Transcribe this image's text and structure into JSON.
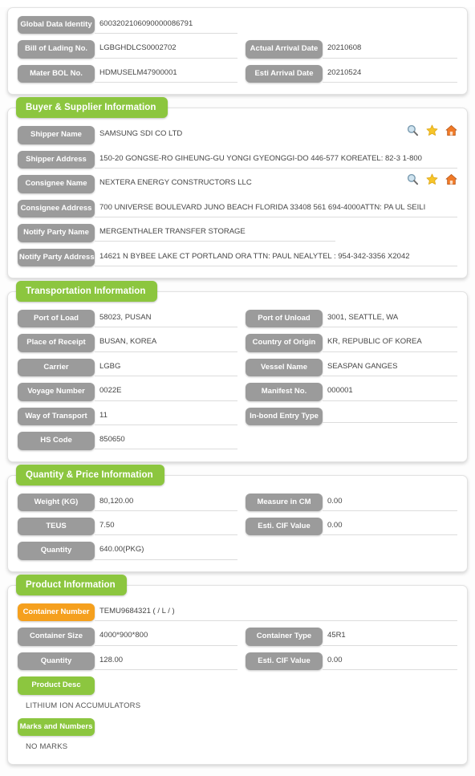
{
  "theme": {
    "accent_green": "#8cc63f",
    "pill_gray": "#9b9b9b",
    "pill_orange": "#f5a01e",
    "text": "#454545"
  },
  "header_card": {
    "fields": [
      {
        "label": "Global Data Identity",
        "value": "6003202106090000086791"
      },
      {
        "label": "Bill of Lading No.",
        "value": "LGBGHDLCS0002702"
      },
      {
        "label": "Actual Arrival Date",
        "value": "20210608"
      },
      {
        "label": "Mater BOL No.",
        "value": "HDMUSELM47900001"
      },
      {
        "label": "Esti Arrival Date",
        "value": "20210524"
      }
    ]
  },
  "buyer_supplier": {
    "title": "Buyer & Supplier Information",
    "fields": [
      {
        "label": "Shipper Name",
        "value": "SAMSUNG SDI CO LTD"
      },
      {
        "label": "Shipper Address",
        "value": "150-20 GONGSE-RO GIHEUNG-GU YONGI GYEONGGI-DO 446-577 KOREATEL: 82-3 1-800"
      },
      {
        "label": "Consignee Name",
        "value": "NEXTERA ENERGY CONSTRUCTORS LLC"
      },
      {
        "label": "Consignee Address",
        "value": "700 UNIVERSE BOULEVARD JUNO BEACH FLORIDA 33408 561 694-4000ATTN: PA UL SEILI"
      },
      {
        "label": "Notify Party Name",
        "value": "MERGENTHALER TRANSFER STORAGE"
      },
      {
        "label": "Notify Party Address",
        "value": "14621 N BYBEE LAKE CT PORTLAND ORA TTN: PAUL NEALYTEL : 954-342-3356 X2042"
      }
    ],
    "icons": [
      "search-icon",
      "star-icon",
      "home-icon"
    ]
  },
  "transportation": {
    "title": "Transportation Information",
    "fields": [
      {
        "label": "Port of Load",
        "value": "58023, PUSAN"
      },
      {
        "label": "Port of Unload",
        "value": "3001, SEATTLE, WA"
      },
      {
        "label": "Place of Receipt",
        "value": "BUSAN, KOREA"
      },
      {
        "label": "Country of Origin",
        "value": "KR, REPUBLIC OF KOREA"
      },
      {
        "label": "Carrier",
        "value": "LGBG"
      },
      {
        "label": "Vessel Name",
        "value": "SEASPAN GANGES"
      },
      {
        "label": "Voyage Number",
        "value": "0022E"
      },
      {
        "label": "Manifest No.",
        "value": "000001"
      },
      {
        "label": "Way of Transport",
        "value": "11"
      },
      {
        "label": "In-bond Entry Type",
        "value": ""
      },
      {
        "label": "HS Code",
        "value": "850650"
      }
    ]
  },
  "quantity_price": {
    "title": "Quantity & Price Information",
    "fields": [
      {
        "label": "Weight (KG)",
        "value": "80,120.00"
      },
      {
        "label": "Measure in CM",
        "value": "0.00"
      },
      {
        "label": "TEUS",
        "value": "7.50"
      },
      {
        "label": "Esti. CIF Value",
        "value": "0.00"
      },
      {
        "label": "Quantity",
        "value": "640.00(PKG)"
      }
    ]
  },
  "product": {
    "title": "Product Information",
    "fields": [
      {
        "label": "Container Number",
        "value": "TEMU9684321 ( / L / )"
      },
      {
        "label": "Container Size",
        "value": "4000*900*800"
      },
      {
        "label": "Container Type",
        "value": "45R1"
      },
      {
        "label": "Quantity",
        "value": "128.00"
      },
      {
        "label": "Esti. CIF Value",
        "value": "0.00"
      }
    ],
    "product_desc_label": "Product Desc",
    "product_desc_text": "LITHIUM ION ACCUMULATORS",
    "marks_label": "Marks and Numbers",
    "marks_text": "NO MARKS"
  }
}
